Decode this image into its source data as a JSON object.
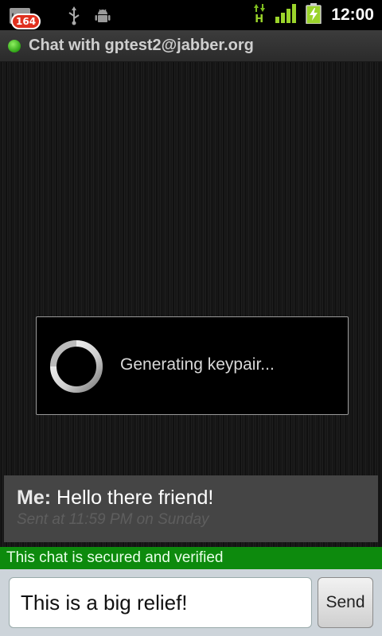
{
  "status_bar": {
    "notification_count": "164",
    "time": "12:00",
    "network_type": "H",
    "icons": [
      "mail-icon",
      "usb-icon",
      "android-debug-icon",
      "network-h-icon",
      "signal-icon",
      "battery-charging-icon"
    ]
  },
  "title_bar": {
    "title": "Chat with gptest2@jabber.org",
    "presence_color": "#3fbf22"
  },
  "dialog": {
    "message": "Generating keypair..."
  },
  "message": {
    "sender": "Me:",
    "text": "Hello there friend!",
    "timestamp": "Sent at 11:59 PM on Sunday"
  },
  "security": {
    "text": "This chat is secured and verified",
    "color": "#0d8a0d"
  },
  "compose": {
    "input_value": "This is a big relief!",
    "send_label": "Send"
  }
}
